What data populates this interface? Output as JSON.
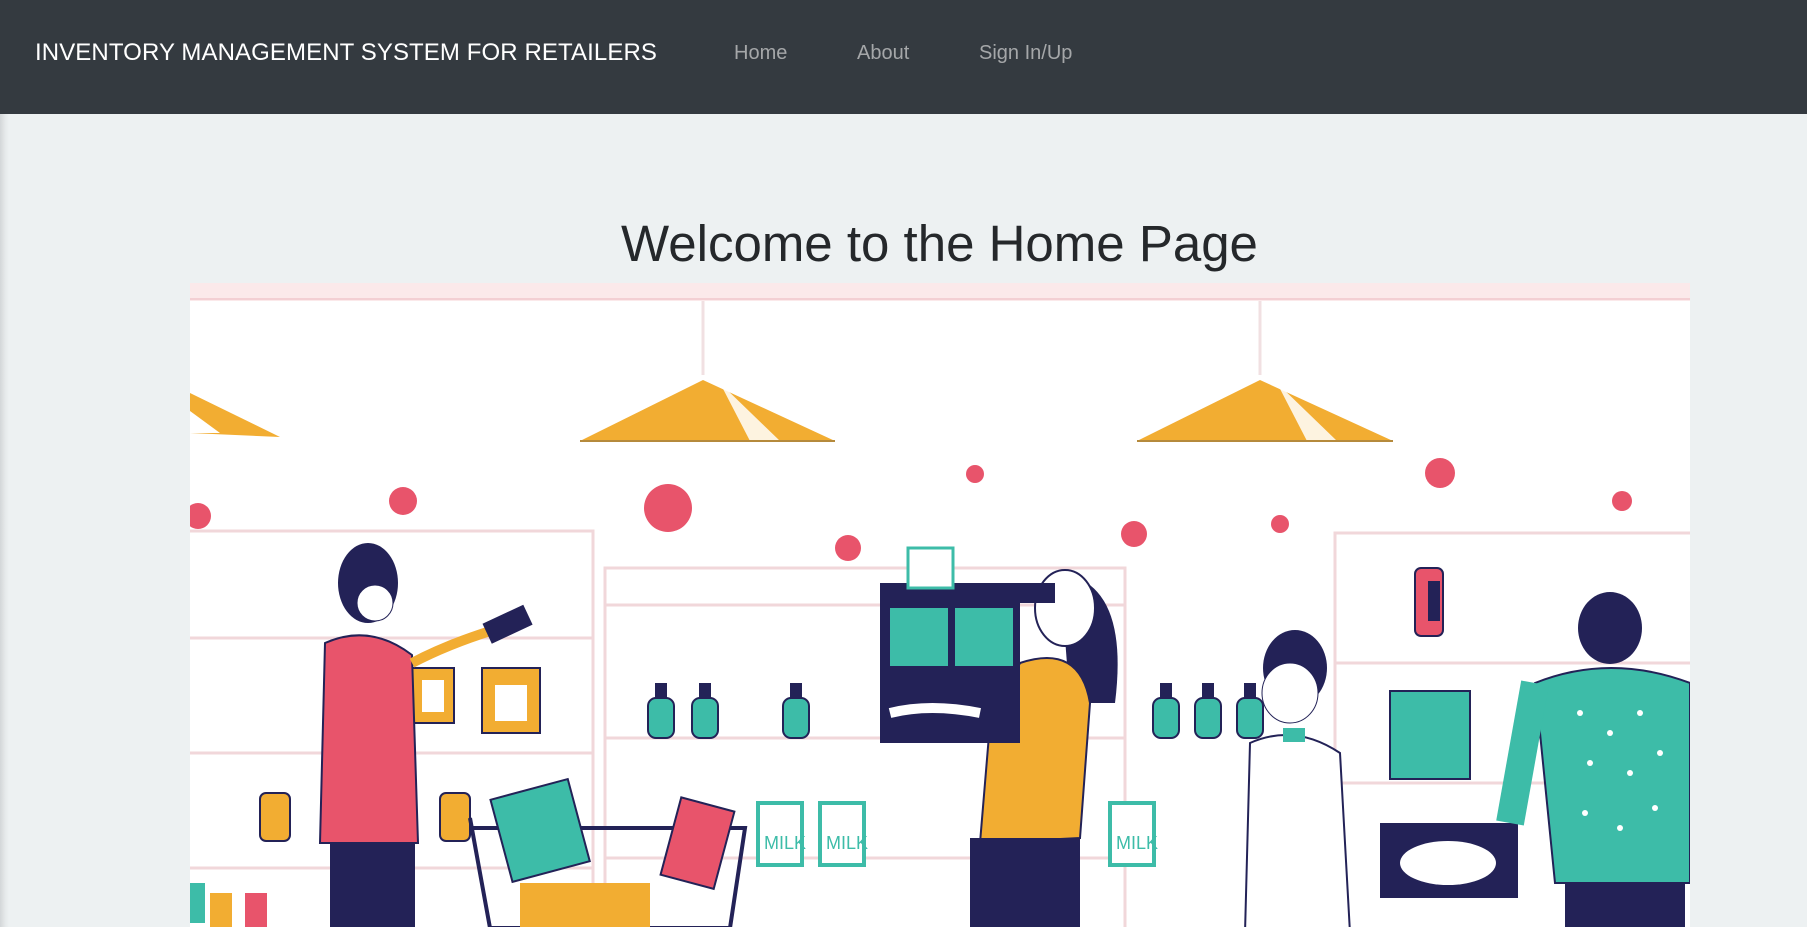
{
  "navbar": {
    "brand": "INVENTORY MANAGEMENT SYSTEM FOR RETAILERS",
    "links": [
      "Home",
      "About",
      "Sign In/Up"
    ],
    "background": "#343a40"
  },
  "main": {
    "heading": "Welcome to the Home Page",
    "hero_image": {
      "alt_icon": "grocery-store-illustration",
      "milk_label": "MILK"
    }
  },
  "colors": {
    "page_bg": "#edf1f2",
    "accent_yellow": "#f2ad32",
    "accent_teal": "#3dbca8",
    "accent_pink": "#e8546b",
    "navy": "#232257"
  }
}
